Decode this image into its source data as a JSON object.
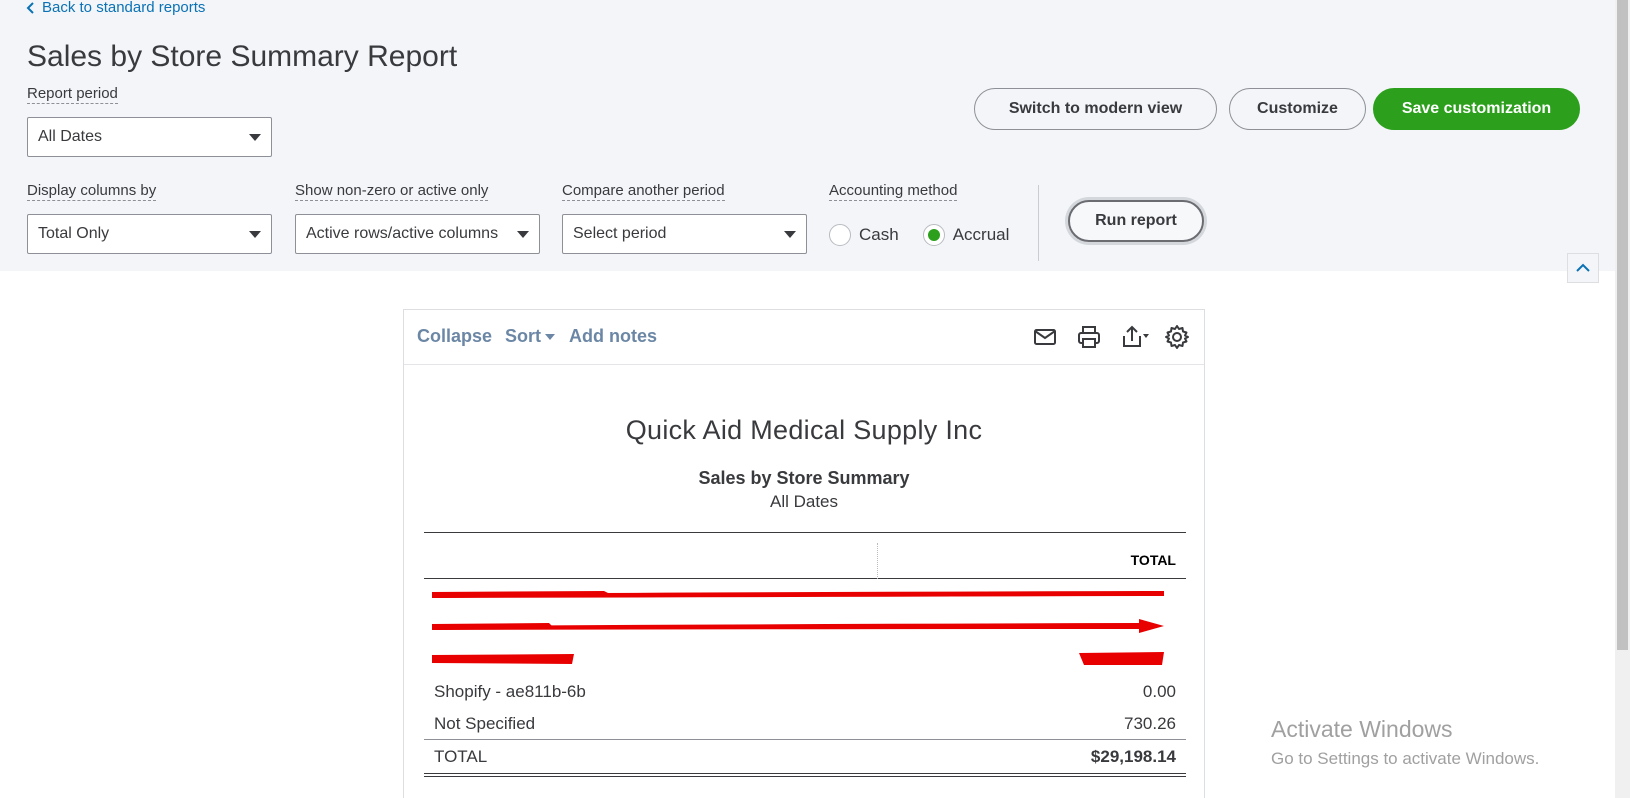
{
  "nav": {
    "back_label": "Back to standard reports"
  },
  "page": {
    "title": "Sales by Store Summary Report"
  },
  "filters": {
    "report_period": {
      "label": "Report period",
      "value": "All Dates"
    },
    "display_columns": {
      "label": "Display columns by",
      "value": "Total Only"
    },
    "show_nonzero": {
      "label": "Show non-zero or active only",
      "value": "Active rows/active columns"
    },
    "compare_period": {
      "label": "Compare another period",
      "value": "Select period"
    },
    "accounting_method": {
      "label": "Accounting method",
      "options": [
        "Cash",
        "Accrual"
      ],
      "selected": "Accrual"
    }
  },
  "actions": {
    "switch_view": "Switch to modern view",
    "customize": "Customize",
    "save_customization": "Save customization",
    "run_report": "Run report"
  },
  "toolbar": {
    "collapse": "Collapse",
    "sort": "Sort",
    "add_notes": "Add notes",
    "icons": [
      "email-icon",
      "print-icon",
      "export-icon",
      "gear-icon"
    ]
  },
  "report": {
    "company": "Quick Aid Medical Supply Inc",
    "name": "Sales by Store Summary",
    "period": "All Dates",
    "column_header": "TOTAL",
    "rows": [
      {
        "name": "",
        "amount": "",
        "redacted": true
      },
      {
        "name": "",
        "amount": "",
        "redacted": true
      },
      {
        "name": "",
        "amount": "",
        "redacted": true
      },
      {
        "name": "Shopify - ae811b-6b",
        "amount": "0.00",
        "redacted": false
      },
      {
        "name": "Not Specified",
        "amount": "730.26",
        "redacted": false
      }
    ],
    "total": {
      "label": "TOTAL",
      "amount": "$29,198.14"
    }
  },
  "watermark": {
    "line1": "Activate Windows",
    "line2": "Go to Settings to activate Windows."
  },
  "colors": {
    "accent_green": "#2ca01c",
    "link_blue": "#0b72b5",
    "toolbar_link": "#6b87a5",
    "redaction_red": "#e80000"
  }
}
